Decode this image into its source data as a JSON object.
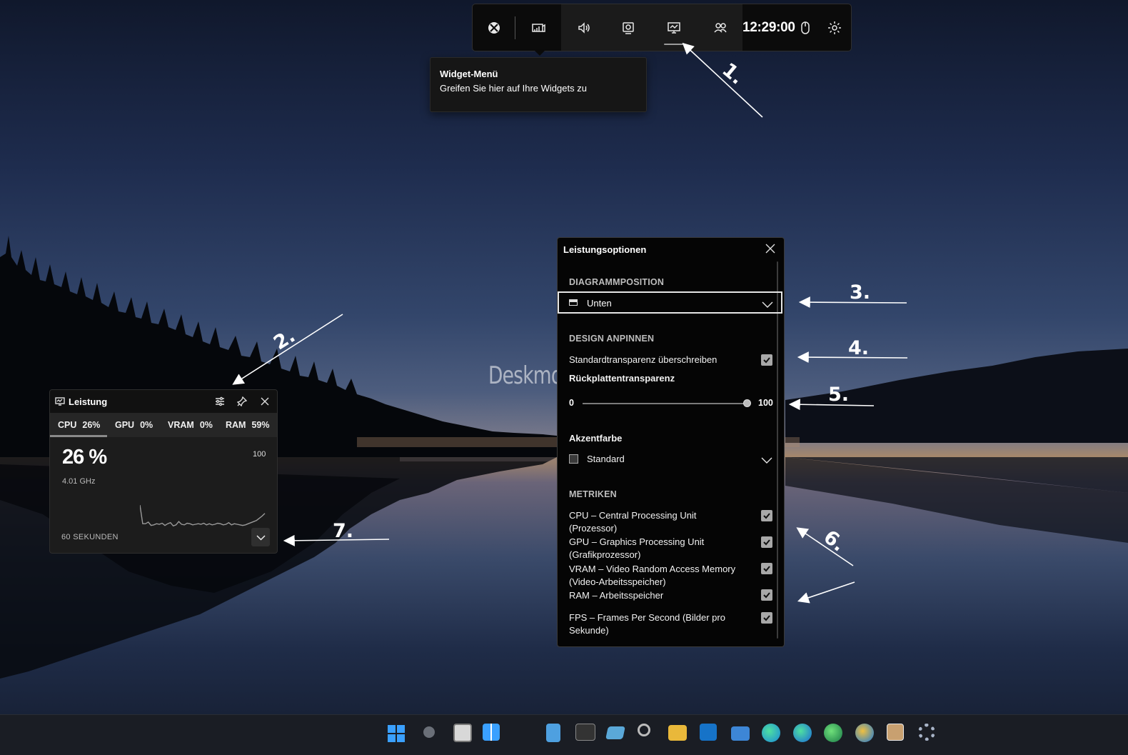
{
  "gamebar": {
    "time": "12:29:00",
    "buttons": [
      "xbox-icon",
      "widgets-icon",
      "audio-icon",
      "capture-icon",
      "performance-icon",
      "social-icon",
      "mouse-icon",
      "settings-icon"
    ]
  },
  "tooltip": {
    "title": "Widget-Menü",
    "text": "Greifen Sie hier auf Ihre Widgets zu"
  },
  "perf": {
    "title": "Leistung",
    "tabs": [
      {
        "label": "CPU",
        "value": "26%"
      },
      {
        "label": "GPU",
        "value": "0%"
      },
      {
        "label": "VRAM",
        "value": "0%"
      },
      {
        "label": "RAM",
        "value": "59%"
      }
    ],
    "big_value": "26 %",
    "freq": "4.01 GHz",
    "max": "100",
    "range": "60 SEKUNDEN",
    "graph_values": [
      48,
      14,
      14,
      17,
      11,
      12,
      14,
      13,
      15,
      11,
      14,
      16,
      10,
      12,
      18,
      13,
      12,
      15,
      14,
      12,
      13,
      14,
      13,
      15,
      12,
      14,
      12,
      13,
      15,
      14,
      12,
      13,
      16,
      12,
      14,
      13,
      12,
      11,
      12,
      14,
      16,
      18,
      20,
      24,
      28,
      33
    ]
  },
  "options": {
    "title": "Leistungsoptionen",
    "section_position": "DIAGRAMMPOSITION",
    "position_value": "Unten",
    "section_design": "DESIGN ANPINNEN",
    "override_label": "Standardtransparenz überschreiben",
    "backplate_label": "Rückplattentransparenz",
    "slider_min": "0",
    "slider_max": "100",
    "slider_value_fraction": 1.0,
    "accent_label": "Akzentfarbe",
    "accent_value": "Standard",
    "section_metrics": "METRIKEN",
    "metrics": [
      {
        "line1": "CPU – Central Processing Unit",
        "line2": "(Prozessor)",
        "checked": true
      },
      {
        "line1": "GPU – Graphics Processing Unit",
        "line2": "(Grafikprozessor)",
        "checked": true
      },
      {
        "line1": "VRAM – Video Random Access Memory",
        "line2": "(Video-Arbeitsspeicher)",
        "checked": true
      },
      {
        "line1": "RAM – Arbeitsspeicher",
        "line2": "",
        "checked": true
      },
      {
        "line1": "FPS – Frames Per Second (Bilder pro",
        "line2": "Sekunde)",
        "checked": true
      }
    ]
  },
  "watermark": "Deskmodder.de",
  "annotations": [
    "1.",
    "2.",
    "3.",
    "4.",
    "5.",
    "6.",
    "7."
  ],
  "taskbar_icons": [
    "start-icon",
    "search-circle-icon",
    "task-view-icon",
    "widgets-icon",
    "notepad-icon",
    "terminal-icon",
    "app-icon",
    "search-icon",
    "file-explorer-icon",
    "outlook-icon",
    "mail-icon",
    "edge-icon",
    "edge-beta-icon",
    "edge-dev-icon",
    "edge-canary-icon",
    "store-icon",
    "settings-icon"
  ]
}
